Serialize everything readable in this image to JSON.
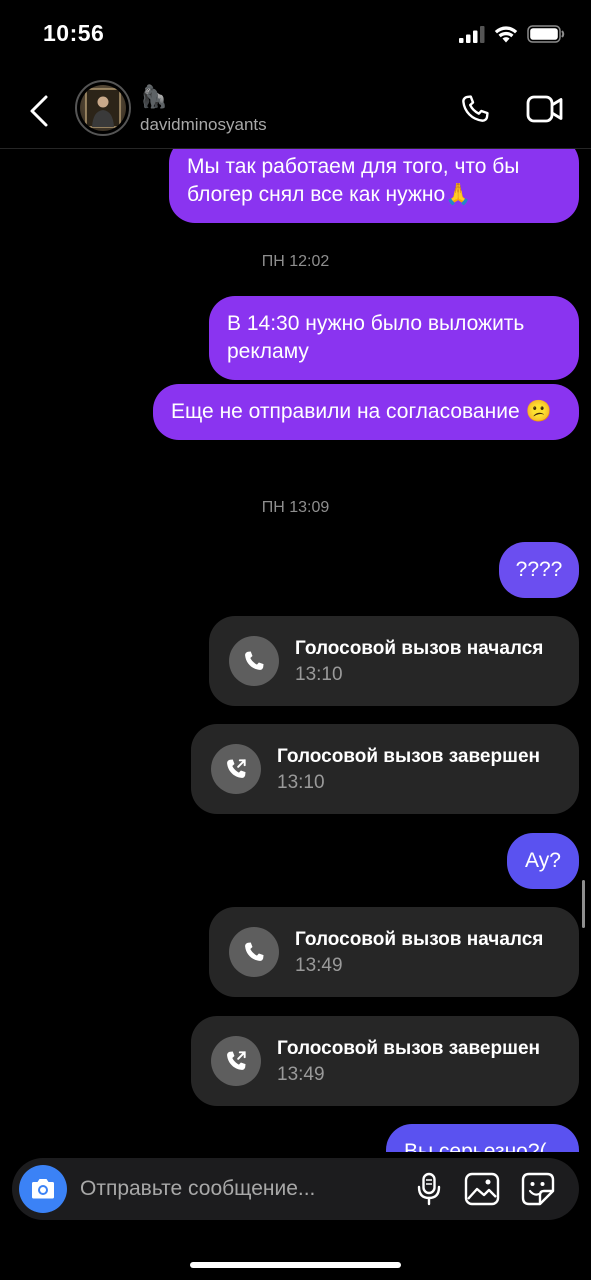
{
  "status_bar": {
    "time": "10:56"
  },
  "header": {
    "display_name": "🦍",
    "username": "davidminosyants"
  },
  "messages": [
    {
      "type": "text",
      "text": "Мы так работаем для того, что бы блогер снял все как нужно🙏"
    },
    {
      "type": "timestamp",
      "text": "ПН 12:02"
    },
    {
      "type": "text",
      "text": "В 14:30 нужно было выложить рекламу"
    },
    {
      "type": "text",
      "text": "Еще не отправили на согласование 😕"
    },
    {
      "type": "timestamp",
      "text": "ПН 13:09"
    },
    {
      "type": "text",
      "text": "????"
    },
    {
      "type": "call",
      "title": "Голосовой вызов начался",
      "time": "13:10"
    },
    {
      "type": "call",
      "title": "Голосовой вызов завершен",
      "time": "13:10"
    },
    {
      "type": "text",
      "text": "Ау?"
    },
    {
      "type": "call",
      "title": "Голосовой вызов начался",
      "time": "13:49"
    },
    {
      "type": "call",
      "title": "Голосовой вызов завершен",
      "time": "13:49"
    },
    {
      "type": "text",
      "text": "Вы серьезно?("
    }
  ],
  "composer": {
    "placeholder": "Отправьте сообщение..."
  },
  "colors": {
    "bubble_purple": "#8a34f0",
    "bubble_indigo": "#6b4ef0",
    "bubble_blue": "#5a52f0",
    "call_card": "#262626",
    "camera_button": "#3b82f6"
  },
  "icons": [
    "back-chevron-icon",
    "phone-icon",
    "video-camera-icon",
    "phone-call-icon",
    "phone-ended-icon",
    "camera-icon",
    "microphone-icon",
    "gallery-icon",
    "sticker-icon"
  ]
}
